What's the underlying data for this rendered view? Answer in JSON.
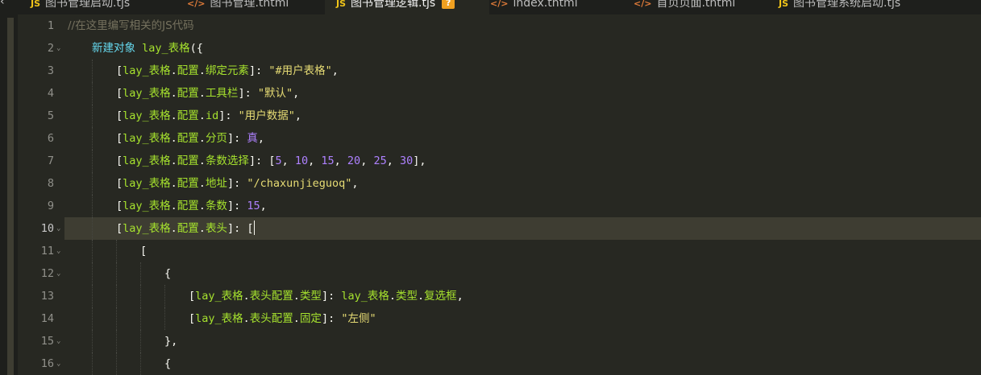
{
  "tabs": [
    {
      "icon": "JS",
      "label": "图书管理启动.tjs",
      "active": false
    },
    {
      "icon": "</>",
      "label": "图书管理.thtml",
      "active": false
    },
    {
      "icon": "JS",
      "label": "图书管理逻辑.tjs",
      "active": true,
      "badge": "?"
    },
    {
      "icon": "</>",
      "label": "index.thtml",
      "active": false
    },
    {
      "icon": "</>",
      "label": "首页页面.thtml",
      "active": false
    },
    {
      "icon": "JS",
      "label": "图书管理系统启动.tjs",
      "active": false
    }
  ],
  "scroll_arrow": "‹",
  "current_line": 10,
  "lines": [
    {
      "n": "1",
      "fold": false,
      "indent": 0,
      "tokens": [
        {
          "t": "//在这里编写相关的JS代码",
          "c": "comment"
        }
      ]
    },
    {
      "n": "2",
      "fold": true,
      "indent": 1,
      "tokens": [
        {
          "t": "新建对象 ",
          "c": "kw"
        },
        {
          "t": "lay_表格",
          "c": "prop"
        },
        {
          "t": "({",
          "c": "punct"
        }
      ]
    },
    {
      "n": "3",
      "fold": false,
      "indent": 2,
      "tokens": [
        {
          "t": "[",
          "c": "punct"
        },
        {
          "t": "lay_表格",
          "c": "prop"
        },
        {
          "t": ".",
          "c": "punct"
        },
        {
          "t": "配置",
          "c": "prop"
        },
        {
          "t": ".",
          "c": "punct"
        },
        {
          "t": "绑定元素",
          "c": "prop"
        },
        {
          "t": "]: ",
          "c": "punct"
        },
        {
          "t": "\"#用户表格\"",
          "c": "str"
        },
        {
          "t": ",",
          "c": "punct"
        }
      ]
    },
    {
      "n": "4",
      "fold": false,
      "indent": 2,
      "tokens": [
        {
          "t": "[",
          "c": "punct"
        },
        {
          "t": "lay_表格",
          "c": "prop"
        },
        {
          "t": ".",
          "c": "punct"
        },
        {
          "t": "配置",
          "c": "prop"
        },
        {
          "t": ".",
          "c": "punct"
        },
        {
          "t": "工具栏",
          "c": "prop"
        },
        {
          "t": "]: ",
          "c": "punct"
        },
        {
          "t": "\"默认\"",
          "c": "str"
        },
        {
          "t": ",",
          "c": "punct"
        }
      ]
    },
    {
      "n": "5",
      "fold": false,
      "indent": 2,
      "tokens": [
        {
          "t": "[",
          "c": "punct"
        },
        {
          "t": "lay_表格",
          "c": "prop"
        },
        {
          "t": ".",
          "c": "punct"
        },
        {
          "t": "配置",
          "c": "prop"
        },
        {
          "t": ".",
          "c": "punct"
        },
        {
          "t": "id",
          "c": "prop"
        },
        {
          "t": "]: ",
          "c": "punct"
        },
        {
          "t": "\"用户数据\"",
          "c": "str"
        },
        {
          "t": ",",
          "c": "punct"
        }
      ]
    },
    {
      "n": "6",
      "fold": false,
      "indent": 2,
      "tokens": [
        {
          "t": "[",
          "c": "punct"
        },
        {
          "t": "lay_表格",
          "c": "prop"
        },
        {
          "t": ".",
          "c": "punct"
        },
        {
          "t": "配置",
          "c": "prop"
        },
        {
          "t": ".",
          "c": "punct"
        },
        {
          "t": "分页",
          "c": "prop"
        },
        {
          "t": "]: ",
          "c": "punct"
        },
        {
          "t": "真",
          "c": "const"
        },
        {
          "t": ",",
          "c": "punct"
        }
      ]
    },
    {
      "n": "7",
      "fold": false,
      "indent": 2,
      "tokens": [
        {
          "t": "[",
          "c": "punct"
        },
        {
          "t": "lay_表格",
          "c": "prop"
        },
        {
          "t": ".",
          "c": "punct"
        },
        {
          "t": "配置",
          "c": "prop"
        },
        {
          "t": ".",
          "c": "punct"
        },
        {
          "t": "条数选择",
          "c": "prop"
        },
        {
          "t": "]: [",
          "c": "punct"
        },
        {
          "t": "5",
          "c": "num"
        },
        {
          "t": ", ",
          "c": "punct"
        },
        {
          "t": "10",
          "c": "num"
        },
        {
          "t": ", ",
          "c": "punct"
        },
        {
          "t": "15",
          "c": "num"
        },
        {
          "t": ", ",
          "c": "punct"
        },
        {
          "t": "20",
          "c": "num"
        },
        {
          "t": ", ",
          "c": "punct"
        },
        {
          "t": "25",
          "c": "num"
        },
        {
          "t": ", ",
          "c": "punct"
        },
        {
          "t": "30",
          "c": "num"
        },
        {
          "t": "],",
          "c": "punct"
        }
      ]
    },
    {
      "n": "8",
      "fold": false,
      "indent": 2,
      "tokens": [
        {
          "t": "[",
          "c": "punct"
        },
        {
          "t": "lay_表格",
          "c": "prop"
        },
        {
          "t": ".",
          "c": "punct"
        },
        {
          "t": "配置",
          "c": "prop"
        },
        {
          "t": ".",
          "c": "punct"
        },
        {
          "t": "地址",
          "c": "prop"
        },
        {
          "t": "]: ",
          "c": "punct"
        },
        {
          "t": "\"/chaxunjieguoq\"",
          "c": "str"
        },
        {
          "t": ",",
          "c": "punct"
        }
      ]
    },
    {
      "n": "9",
      "fold": false,
      "indent": 2,
      "tokens": [
        {
          "t": "[",
          "c": "punct"
        },
        {
          "t": "lay_表格",
          "c": "prop"
        },
        {
          "t": ".",
          "c": "punct"
        },
        {
          "t": "配置",
          "c": "prop"
        },
        {
          "t": ".",
          "c": "punct"
        },
        {
          "t": "条数",
          "c": "prop"
        },
        {
          "t": "]: ",
          "c": "punct"
        },
        {
          "t": "15",
          "c": "num"
        },
        {
          "t": ",",
          "c": "punct"
        }
      ]
    },
    {
      "n": "10",
      "fold": true,
      "indent": 2,
      "tokens": [
        {
          "t": "[",
          "c": "punct"
        },
        {
          "t": "lay_表格",
          "c": "prop"
        },
        {
          "t": ".",
          "c": "punct"
        },
        {
          "t": "配置",
          "c": "prop"
        },
        {
          "t": ".",
          "c": "punct"
        },
        {
          "t": "表头",
          "c": "prop"
        },
        {
          "t": "]: [",
          "c": "punct"
        }
      ]
    },
    {
      "n": "11",
      "fold": true,
      "indent": 3,
      "tokens": [
        {
          "t": "[",
          "c": "punct"
        }
      ]
    },
    {
      "n": "12",
      "fold": true,
      "indent": 4,
      "tokens": [
        {
          "t": "{",
          "c": "punct"
        }
      ]
    },
    {
      "n": "13",
      "fold": false,
      "indent": 5,
      "tokens": [
        {
          "t": "[",
          "c": "punct"
        },
        {
          "t": "lay_表格",
          "c": "prop"
        },
        {
          "t": ".",
          "c": "punct"
        },
        {
          "t": "表头配置",
          "c": "prop"
        },
        {
          "t": ".",
          "c": "punct"
        },
        {
          "t": "类型",
          "c": "prop"
        },
        {
          "t": "]: ",
          "c": "punct"
        },
        {
          "t": "lay_表格",
          "c": "prop"
        },
        {
          "t": ".",
          "c": "punct"
        },
        {
          "t": "类型",
          "c": "prop"
        },
        {
          "t": ".",
          "c": "punct"
        },
        {
          "t": "复选框",
          "c": "prop"
        },
        {
          "t": ",",
          "c": "punct"
        }
      ]
    },
    {
      "n": "14",
      "fold": false,
      "indent": 5,
      "tokens": [
        {
          "t": "[",
          "c": "punct"
        },
        {
          "t": "lay_表格",
          "c": "prop"
        },
        {
          "t": ".",
          "c": "punct"
        },
        {
          "t": "表头配置",
          "c": "prop"
        },
        {
          "t": ".",
          "c": "punct"
        },
        {
          "t": "固定",
          "c": "prop"
        },
        {
          "t": "]: ",
          "c": "punct"
        },
        {
          "t": "\"左侧\"",
          "c": "str"
        }
      ]
    },
    {
      "n": "15",
      "fold": true,
      "indent": 4,
      "tokens": [
        {
          "t": "},",
          "c": "punct"
        }
      ]
    },
    {
      "n": "16",
      "fold": true,
      "indent": 4,
      "tokens": [
        {
          "t": "{",
          "c": "punct"
        }
      ]
    }
  ]
}
